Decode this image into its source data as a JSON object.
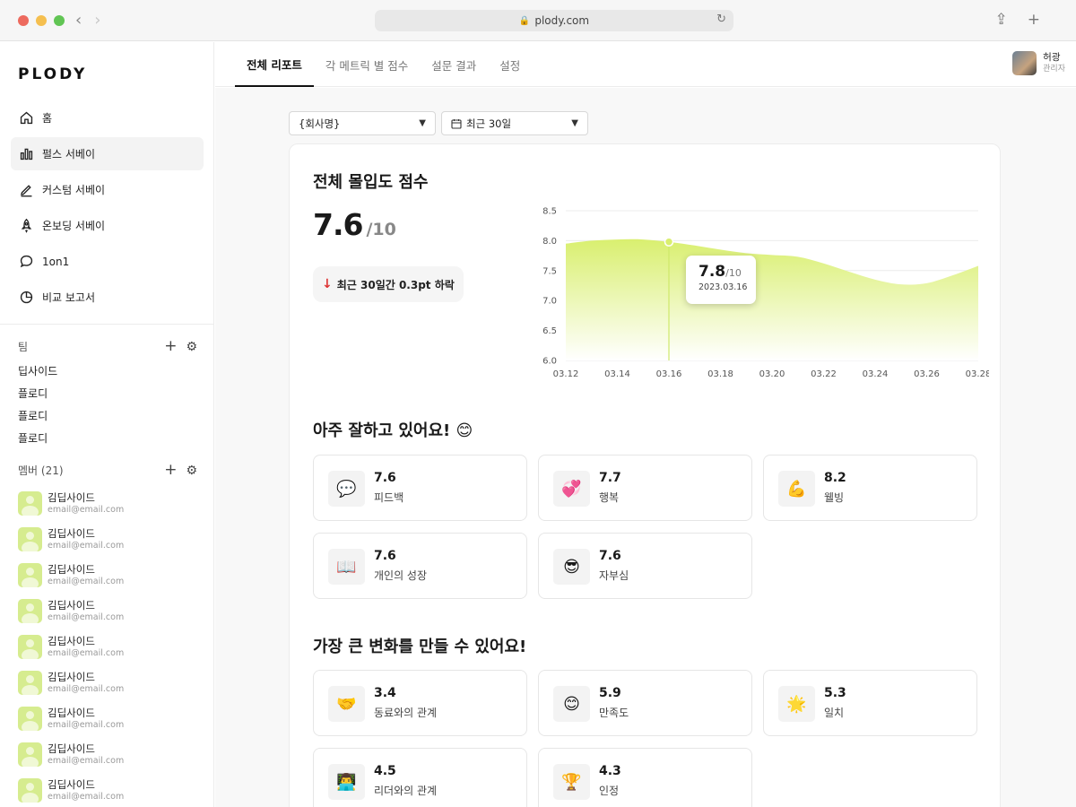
{
  "browser": {
    "url": "plody.com",
    "colors": {
      "close": "#ed6a5e",
      "minimize": "#f5bf4f",
      "maximize": "#61c554"
    }
  },
  "sidebar": {
    "logo": "PLODY",
    "menu": [
      {
        "label": "홈",
        "icon": "home-icon",
        "active": false
      },
      {
        "label": "펄스 서베이",
        "icon": "bar-chart-icon",
        "active": true
      },
      {
        "label": "커스텀 서베이",
        "icon": "pen-icon",
        "active": false
      },
      {
        "label": "온보딩 서베이",
        "icon": "rocket-icon",
        "active": false
      },
      {
        "label": "1on1",
        "icon": "chat-bubble-icon",
        "active": false
      },
      {
        "label": "비교 보고서",
        "icon": "pie-chart-icon",
        "active": false
      }
    ],
    "team_header": "팀",
    "teams": [
      "딥사이드",
      "플로디",
      "플로디",
      "플로디"
    ],
    "member_header": "멤버 (21)",
    "members": [
      {
        "name": "김딥사이드",
        "email": "email@email.com"
      },
      {
        "name": "김딥사이드",
        "email": "email@email.com"
      },
      {
        "name": "김딥사이드",
        "email": "email@email.com"
      },
      {
        "name": "김딥사이드",
        "email": "email@email.com"
      },
      {
        "name": "김딥사이드",
        "email": "email@email.com"
      },
      {
        "name": "김딥사이드",
        "email": "email@email.com"
      },
      {
        "name": "김딥사이드",
        "email": "email@email.com"
      },
      {
        "name": "김딥사이드",
        "email": "email@email.com"
      },
      {
        "name": "김딥사이드",
        "email": "email@email.com"
      }
    ]
  },
  "topbar": {
    "tabs": [
      {
        "label": "전체 리포트",
        "active": true
      },
      {
        "label": "각 메트릭 별 점수",
        "active": false
      },
      {
        "label": "설문 결과",
        "active": false
      },
      {
        "label": "설정",
        "active": false
      }
    ],
    "user": {
      "name": "허광",
      "role": "관리자"
    }
  },
  "filters": {
    "company": "{회사명}",
    "period": "최근 30일"
  },
  "overall": {
    "title": "전체 몰입도 점수",
    "score": "7.6",
    "max": "/10",
    "trend": "최근 30일간 0.3pt 하락",
    "tooltip": {
      "value": "7.8",
      "max": "/10",
      "date": "2023.03.16"
    }
  },
  "chart_data": {
    "type": "area",
    "x": [
      "03.12",
      "03.13",
      "03.14",
      "03.15",
      "03.16",
      "03.17",
      "03.18",
      "03.19",
      "03.20",
      "03.21",
      "03.22",
      "03.23",
      "03.24",
      "03.25",
      "03.26",
      "03.27",
      "03.28"
    ],
    "x_ticks": [
      "03.12",
      "03.14",
      "03.16",
      "03.18",
      "03.20",
      "03.22",
      "03.24",
      "03.26",
      "03.28"
    ],
    "values": [
      7.95,
      8.0,
      8.02,
      8.02,
      7.98,
      7.92,
      7.85,
      7.79,
      7.76,
      7.73,
      7.62,
      7.48,
      7.35,
      7.27,
      7.29,
      7.42,
      7.58
    ],
    "highlight": {
      "x": "03.16",
      "y": 7.98
    },
    "ylim": [
      6.0,
      8.5
    ],
    "y_ticks": [
      "6.0",
      "6.5",
      "7.0",
      "7.5",
      "8.0",
      "8.5"
    ],
    "grid": true,
    "color": "#d9ef6f"
  },
  "strengths": {
    "title": "아주 잘하고 있어요! 😊",
    "items": [
      {
        "emoji": "💬",
        "score": "7.6",
        "label": "피드백"
      },
      {
        "emoji": "💞",
        "score": "7.7",
        "label": "행복"
      },
      {
        "emoji": "💪",
        "score": "8.2",
        "label": "웰빙"
      },
      {
        "emoji": "📖",
        "score": "7.6",
        "label": "개인의 성장"
      },
      {
        "emoji": "😎",
        "score": "7.6",
        "label": "자부심"
      }
    ]
  },
  "improvements": {
    "title": "가장 큰 변화를 만들 수 있어요!",
    "items": [
      {
        "emoji": "🤝",
        "score": "3.4",
        "label": "동료와의 관계"
      },
      {
        "emoji": "😊",
        "score": "5.9",
        "label": "만족도"
      },
      {
        "emoji": "🌟",
        "score": "5.3",
        "label": "일치"
      },
      {
        "emoji": "👨‍💻",
        "score": "4.5",
        "label": "리더와의 관계"
      },
      {
        "emoji": "🏆",
        "score": "4.3",
        "label": "인정"
      }
    ]
  }
}
